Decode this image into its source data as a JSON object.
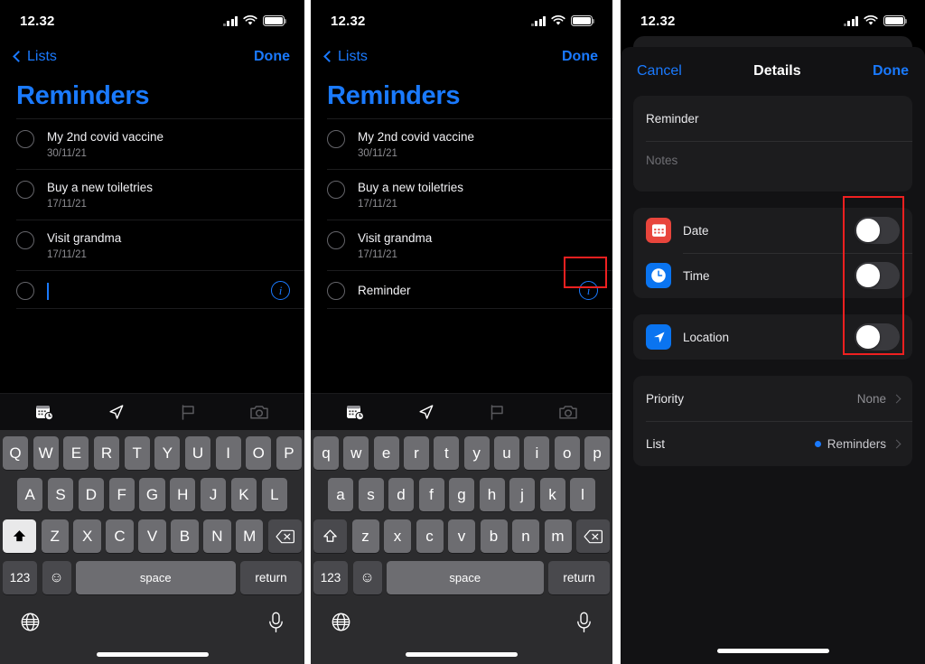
{
  "statusbar": {
    "time": "12.32",
    "signal_icon": "cellular-bars-icon",
    "wifi_icon": "wifi-icon",
    "battery_icon": "battery-icon"
  },
  "panel1": {
    "nav": {
      "back_label": "Lists",
      "back_icon": "chevron-left-icon",
      "done_label": "Done"
    },
    "title": "Reminders",
    "items": [
      {
        "title": "My 2nd covid vaccine",
        "date": "30/11/21"
      },
      {
        "title": "Buy a new toiletries",
        "date": "17/11/21"
      },
      {
        "title": "Visit grandma",
        "date": "17/11/21"
      },
      {
        "title": "",
        "date": "",
        "editing": true,
        "info_icon": "info-circle-icon"
      }
    ],
    "toolbar": [
      {
        "icon": "calendar-clock-icon",
        "active": true
      },
      {
        "icon": "location-arrow-icon",
        "active": true
      },
      {
        "icon": "flag-icon",
        "active": false
      },
      {
        "icon": "camera-icon",
        "active": false
      }
    ],
    "keyboard": {
      "row1": [
        "Q",
        "W",
        "E",
        "R",
        "T",
        "Y",
        "U",
        "I",
        "O",
        "P"
      ],
      "row2": [
        "A",
        "S",
        "D",
        "F",
        "G",
        "H",
        "J",
        "K",
        "L"
      ],
      "row3": [
        "Z",
        "X",
        "C",
        "V",
        "B",
        "N",
        "M"
      ],
      "shift_icon": "shift-filled-icon",
      "backspace_icon": "backspace-icon",
      "numbers_label": "123",
      "emoji_icon": "emoji-icon",
      "space_label": "space",
      "return_label": "return",
      "globe_icon": "globe-icon",
      "mic_icon": "microphone-icon"
    }
  },
  "panel2": {
    "nav": {
      "back_label": "Lists",
      "back_icon": "chevron-left-icon",
      "done_label": "Done"
    },
    "title": "Reminders",
    "items": [
      {
        "title": "My 2nd covid vaccine",
        "date": "30/11/21"
      },
      {
        "title": "Buy a new toiletries",
        "date": "17/11/21"
      },
      {
        "title": "Visit grandma",
        "date": "17/11/21"
      },
      {
        "title": "Reminder",
        "date": "",
        "info_icon": "info-circle-icon",
        "highlighted": true
      }
    ],
    "toolbar": [
      {
        "icon": "calendar-clock-icon",
        "active": true
      },
      {
        "icon": "location-arrow-icon",
        "active": true
      },
      {
        "icon": "flag-icon",
        "active": false
      },
      {
        "icon": "camera-icon",
        "active": false
      }
    ],
    "keyboard": {
      "row1": [
        "q",
        "w",
        "e",
        "r",
        "t",
        "y",
        "u",
        "i",
        "o",
        "p"
      ],
      "row2": [
        "a",
        "s",
        "d",
        "f",
        "g",
        "h",
        "j",
        "k",
        "l"
      ],
      "row3": [
        "z",
        "x",
        "c",
        "v",
        "b",
        "n",
        "m"
      ],
      "shift_icon": "shift-outline-icon",
      "backspace_icon": "backspace-icon",
      "numbers_label": "123",
      "emoji_icon": "emoji-icon",
      "space_label": "space",
      "return_label": "return",
      "globe_icon": "globe-icon",
      "mic_icon": "microphone-icon"
    }
  },
  "panel3": {
    "nav": {
      "cancel_label": "Cancel",
      "title": "Details",
      "done_label": "Done"
    },
    "fields": {
      "reminder_value": "Reminder",
      "notes_placeholder": "Notes"
    },
    "toggles": [
      {
        "label": "Date",
        "icon": "calendar-icon",
        "icon_color": "#e8453c",
        "on": false
      },
      {
        "label": "Time",
        "icon": "clock-icon",
        "icon_color": "#0a74f0",
        "on": false
      },
      {
        "label": "Location",
        "icon": "location-arrow-icon",
        "icon_color": "#0a74f0",
        "on": false
      }
    ],
    "options": [
      {
        "label": "Priority",
        "value": "None",
        "chevron_icon": "chevron-right-icon",
        "has_dot": false
      },
      {
        "label": "List",
        "value": "Reminders",
        "chevron_icon": "chevron-right-icon",
        "has_dot": true,
        "dot_color": "#1a7aff"
      }
    ]
  },
  "annotations": {
    "highlight_color": "#ef2020"
  }
}
